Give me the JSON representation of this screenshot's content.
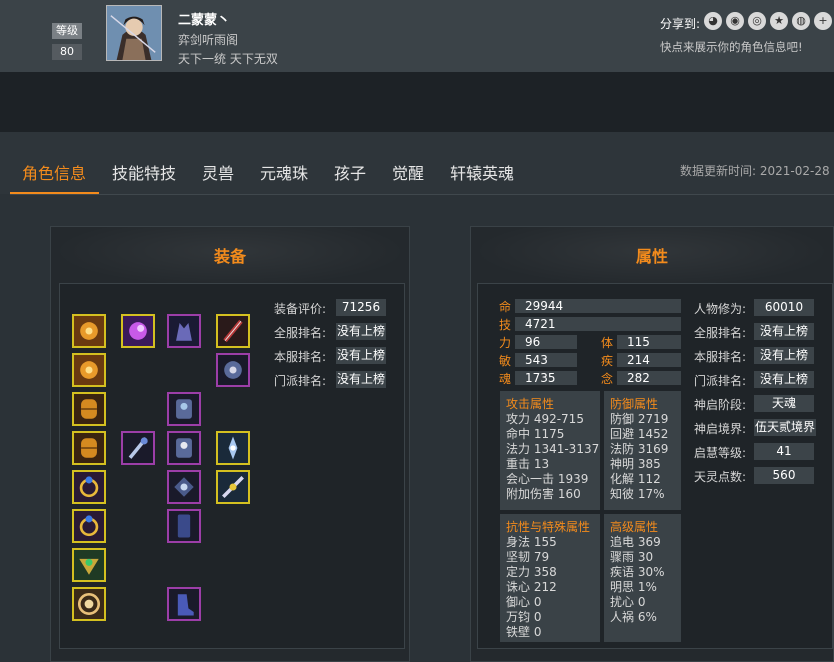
{
  "header": {
    "level_label": "等级",
    "level_value": "80",
    "name": "二蒙蒙丶",
    "guild": "弈剑听雨阁",
    "motto": "天下一统 天下无双",
    "share_label": "分享到:",
    "share_tip": "快点来展示你的角色信息吧!",
    "share_icons": [
      "wechat-icon",
      "qq-icon",
      "weibo-icon",
      "star-icon",
      "moments-icon",
      "add-icon"
    ]
  },
  "tabs": [
    {
      "label": "角色信息",
      "active": true
    },
    {
      "label": "技能特技",
      "active": false
    },
    {
      "label": "灵兽",
      "active": false
    },
    {
      "label": "元魂珠",
      "active": false
    },
    {
      "label": "孩子",
      "active": false
    },
    {
      "label": "觉醒",
      "active": false
    },
    {
      "label": "轩辕英魂",
      "active": false
    }
  ],
  "update": {
    "label": "数据更新时间:",
    "value": "2021-02-28"
  },
  "equipment": {
    "title": "装备",
    "stats": [
      {
        "label": "装备评价:",
        "value": "71256"
      },
      {
        "label": "全服排名:",
        "value": "没有上榜"
      },
      {
        "label": "本服排名:",
        "value": "没有上榜"
      },
      {
        "label": "门派排名:",
        "value": "没有上榜"
      }
    ]
  },
  "attributes": {
    "title": "属性",
    "main": [
      {
        "key": "命",
        "value": "29944"
      },
      {
        "key": "技",
        "value": "4721"
      }
    ],
    "pairs": [
      {
        "k1": "力",
        "v1": "96",
        "k2": "体",
        "v2": "115"
      },
      {
        "k1": "敏",
        "v1": "543",
        "k2": "疾",
        "v2": "214"
      },
      {
        "k1": "魂",
        "v1": "1735",
        "k2": "念",
        "v2": "282"
      }
    ],
    "attack": {
      "title": "攻击属性",
      "lines": [
        "攻力 492-715",
        "命中 1175",
        "法力 1341-3137",
        "重击 13",
        "会心一击 1939",
        "附加伤害 160"
      ]
    },
    "defense": {
      "title": "防御属性",
      "lines": [
        "防御 2719",
        "回避 1452",
        "法防 3169",
        "神明 385",
        "化解 112",
        "知彼 17%"
      ]
    },
    "resist": {
      "title": "抗性与特殊属性",
      "lines": [
        "身法 155",
        "坚韧 79",
        "定力 358",
        "诛心 212",
        "御心 0",
        "万钧 0",
        "铁壁 0"
      ]
    },
    "advanced": {
      "title": "高级属性",
      "lines": [
        "追电 369",
        "骤雨 30",
        "疾语 30%",
        "明思 1%",
        "扰心 0",
        "人祸 6%"
      ]
    },
    "side": [
      {
        "label": "人物修为:",
        "value": "60010"
      },
      {
        "label": "全服排名:",
        "value": "没有上榜"
      },
      {
        "label": "本服排名:",
        "value": "没有上榜"
      },
      {
        "label": "门派排名:",
        "value": "没有上榜"
      },
      {
        "label": "神启阶段:",
        "value": "天魂"
      },
      {
        "label": "神启境界:",
        "value": "伍天贰境界"
      },
      {
        "label": "启慧等级:",
        "value": "41"
      },
      {
        "label": "天灵点数:",
        "value": "560"
      }
    ]
  },
  "colors": {
    "accent": "#f38b1c",
    "gold_border": "#d4c020",
    "purple_border": "#9c3ea8"
  }
}
